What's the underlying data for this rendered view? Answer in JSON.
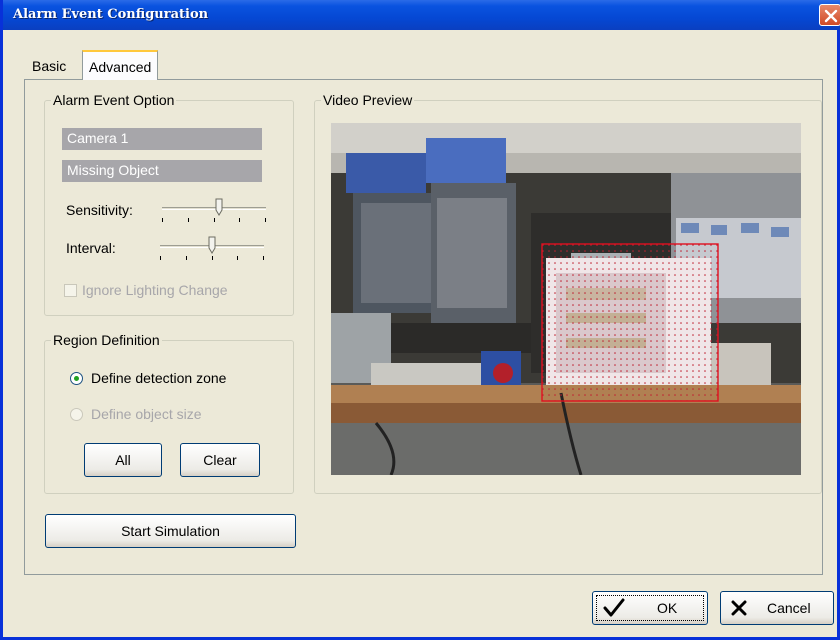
{
  "window": {
    "title": "Alarm Event Configuration"
  },
  "tabs": {
    "basic": "Basic",
    "advanced": "Advanced"
  },
  "alarm_event_option": {
    "legend": "Alarm Event Option",
    "camera": "Camera 1",
    "event": "Missing Object",
    "sensitivity_label": "Sensitivity:",
    "sensitivity_level": 0.55,
    "interval_label": "Interval:",
    "interval_level": 0.5,
    "ignore_lighting_label": "Ignore Lighting Change"
  },
  "region_definition": {
    "legend": "Region Definition",
    "define_zone_label": "Define detection zone",
    "define_size_label": "Define object size",
    "all_label": "All",
    "clear_label": "Clear"
  },
  "start_simulation_label": "Start Simulation",
  "video_preview": {
    "legend": "Video Preview"
  },
  "footer": {
    "ok_label": "OK",
    "cancel_label": "Cancel"
  },
  "colors": {
    "titlebar": "#0548d4",
    "detection_zone": "#e01020",
    "disabled_field": "#a7a6aa"
  }
}
